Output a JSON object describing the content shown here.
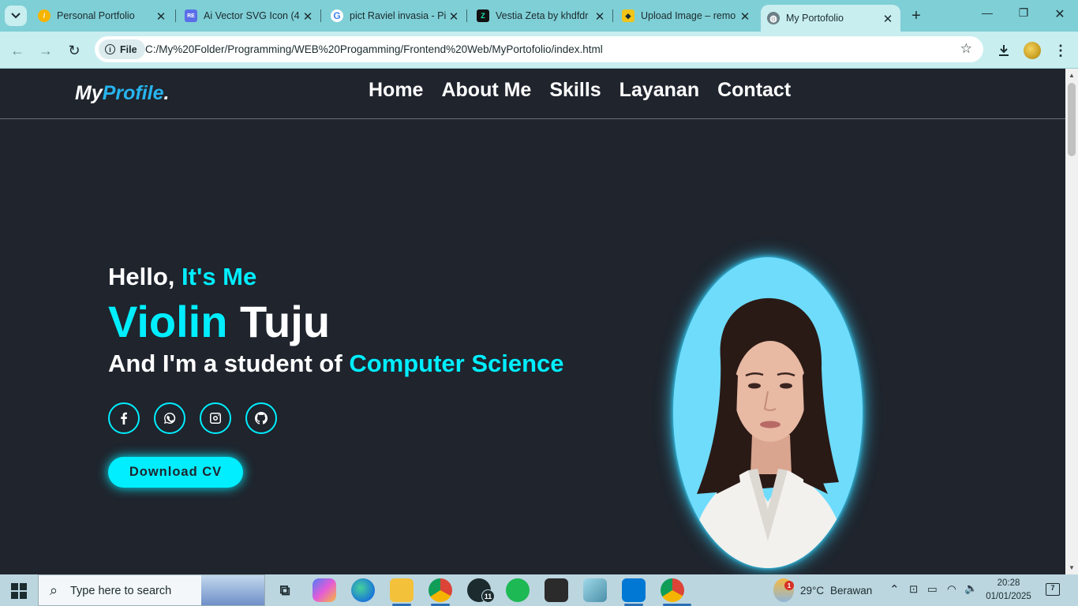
{
  "browser": {
    "tabs": [
      {
        "title": "Personal Portfolio",
        "icon": "portfolio-favicon",
        "color": "#f5b400",
        "glyph": "/"
      },
      {
        "title": "Ai Vector SVG Icon (4",
        "icon": "svgrepo-favicon",
        "color": "#5a6ee8",
        "glyph": "RE"
      },
      {
        "title": "pict Raviel invasia - Pi",
        "icon": "google-favicon",
        "color": "#ffffff",
        "glyph": "G"
      },
      {
        "title": "Vestia Zeta by khdfdr",
        "icon": "vestia-favicon",
        "color": "#111111",
        "glyph": "Z"
      },
      {
        "title": "Upload Image – remo",
        "icon": "upload-favicon",
        "color": "#f0c419",
        "glyph": "◆"
      },
      {
        "title": "My Portofolio",
        "icon": "globe-favicon",
        "color": "#6b7f86",
        "glyph": "◍"
      }
    ],
    "site_chip": "File",
    "url": "C:/My%20Folder/Programming/WEB%20Progamming/Frontend%20Web/MyPortofolio/index.html"
  },
  "site": {
    "logo_main": "My",
    "logo_accent": "Profile",
    "logo_dot": ".",
    "nav": [
      "Home",
      "About Me",
      "Skills",
      "Layanan",
      "Contact"
    ],
    "hello": "Hello, ",
    "hello_accent": "It's Me",
    "first_name": "Violin",
    "last_name": " Tuju",
    "sub": "And I'm a student of ",
    "sub_accent": "Computer Science",
    "socials": [
      "facebook-icon",
      "whatsapp-icon",
      "instagram-icon",
      "github-icon"
    ],
    "cv_button": "Download CV",
    "accent_color": "#00eeff",
    "bg_color": "#1f242d"
  },
  "taskbar": {
    "search_placeholder": "Type here to search",
    "weather_temp": "29°C",
    "weather_text": "Berawan",
    "weather_badge": "1",
    "whatsapp_badge": "11",
    "time": "20:28",
    "date": "01/01/2025",
    "notification_count": "7"
  }
}
